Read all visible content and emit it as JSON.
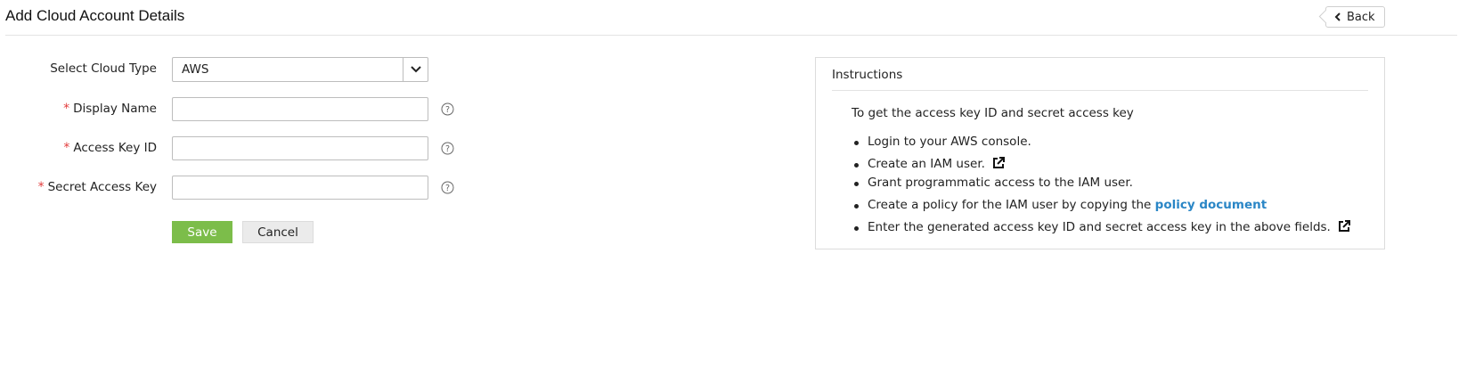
{
  "header": {
    "title": "Add Cloud Account Details",
    "back_label": "Back"
  },
  "form": {
    "cloud_type_label": "Select Cloud Type",
    "cloud_type_value": "AWS",
    "display_name_label": "Display Name",
    "display_name_value": "",
    "access_key_label": "Access Key ID",
    "access_key_value": "",
    "secret_key_label": "Secret Access Key",
    "secret_key_value": "",
    "required_marker": "*",
    "save_label": "Save",
    "cancel_label": "Cancel"
  },
  "instructions": {
    "title": "Instructions",
    "intro": "To get the access key ID and secret access key",
    "items": [
      {
        "text": "Login to your AWS console."
      },
      {
        "text": "Create an IAM user."
      },
      {
        "text": "Grant programmatic access to the IAM user."
      },
      {
        "text": "Create a policy for the IAM user by copying the ",
        "link": "policy document"
      },
      {
        "text": "Enter the generated access key ID and secret access key in the above fields."
      }
    ]
  },
  "colors": {
    "save": "#7cbd4a",
    "required": "#e23b3b",
    "link": "#2a86c6"
  },
  "icons": {
    "back": "chevron-left-icon",
    "dropdown": "chevron-down-icon",
    "help": "help-circle-icon",
    "external": "external-link-icon"
  }
}
